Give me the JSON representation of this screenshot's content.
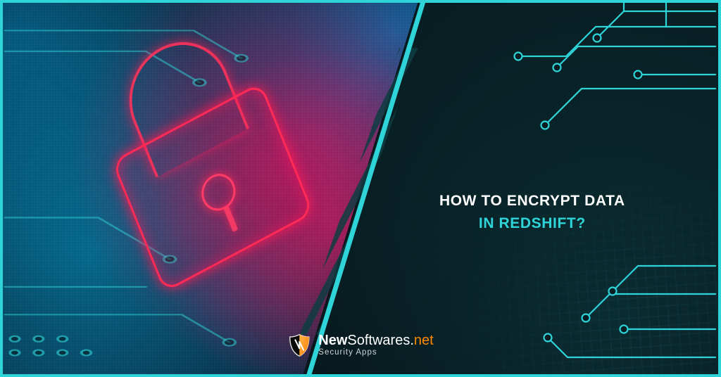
{
  "title": {
    "line1": "HOW TO ENCRYPT DATA",
    "line2": "IN REDSHIFT?"
  },
  "brand": {
    "name_bold": "New",
    "name_light": "Softwares",
    "dot": ".",
    "tld": "net",
    "tagline": "Security Apps"
  },
  "colors": {
    "accent": "#2fd4d8",
    "bg": "#06171b",
    "tld": "#ff8a00"
  },
  "icons": {
    "lock": "lock-icon",
    "shield": "shield-icon",
    "circuit": "circuit-icon"
  }
}
